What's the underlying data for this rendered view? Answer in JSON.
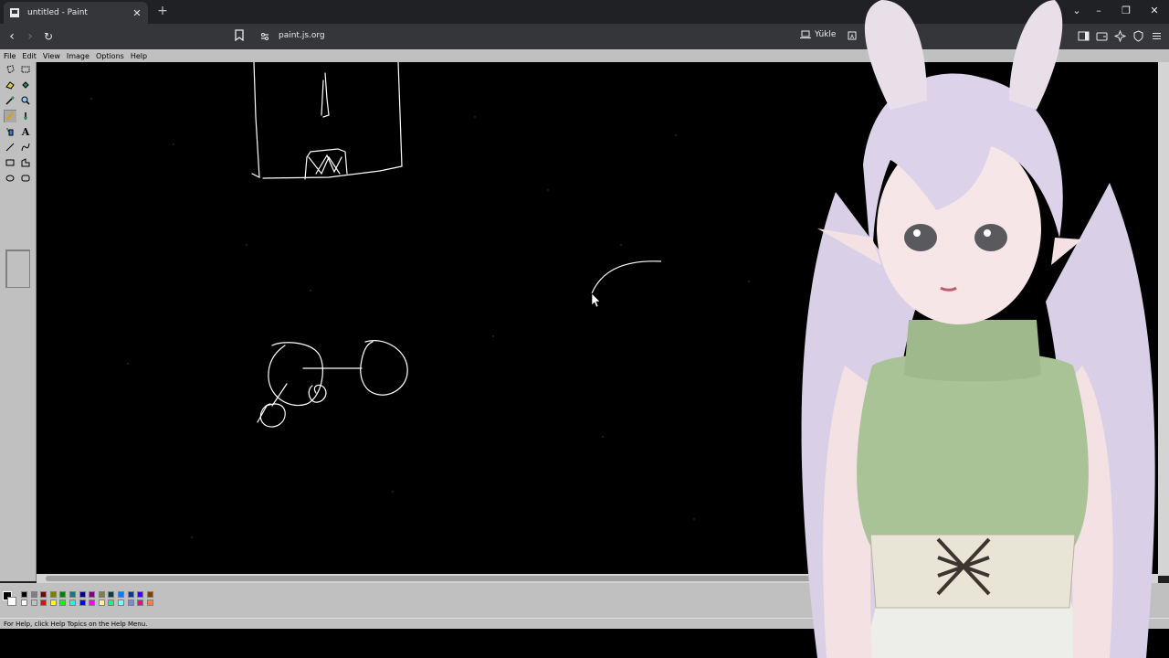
{
  "browser": {
    "tab_title": "untitled - Paint",
    "url": "paint.js.org",
    "install_label": "Yükle"
  },
  "menu": {
    "items": [
      "File",
      "Edit",
      "View",
      "Image",
      "Options",
      "Help"
    ]
  },
  "tools": [
    "free-form-select",
    "select",
    "eraser",
    "fill",
    "color-picker",
    "magnifier",
    "pencil",
    "brush",
    "airbrush",
    "text",
    "line",
    "curve",
    "rectangle",
    "polygon",
    "ellipse",
    "rounded-rectangle"
  ],
  "palette": {
    "row1": [
      "#000000",
      "#808080",
      "#800000",
      "#808000",
      "#008000",
      "#008080",
      "#000080",
      "#800080",
      "#808040",
      "#004040",
      "#0080ff",
      "#004080",
      "#4000ff",
      "#804000"
    ],
    "row2": [
      "#ffffff",
      "#c0c0c0",
      "#ff0000",
      "#ffff00",
      "#00ff00",
      "#00ffff",
      "#0000ff",
      "#ff00ff",
      "#ffff80",
      "#00ff80",
      "#80ffff",
      "#8080ff",
      "#ff0080",
      "#ff8040"
    ],
    "primary": "#000000",
    "secondary": "#ffffff"
  },
  "status": {
    "help_text": "For Help, click Help Topics on the Help Menu."
  },
  "colors": {
    "canvas": "#000000",
    "stroke": "#ffffff",
    "chrome": "#c0c0c0"
  }
}
